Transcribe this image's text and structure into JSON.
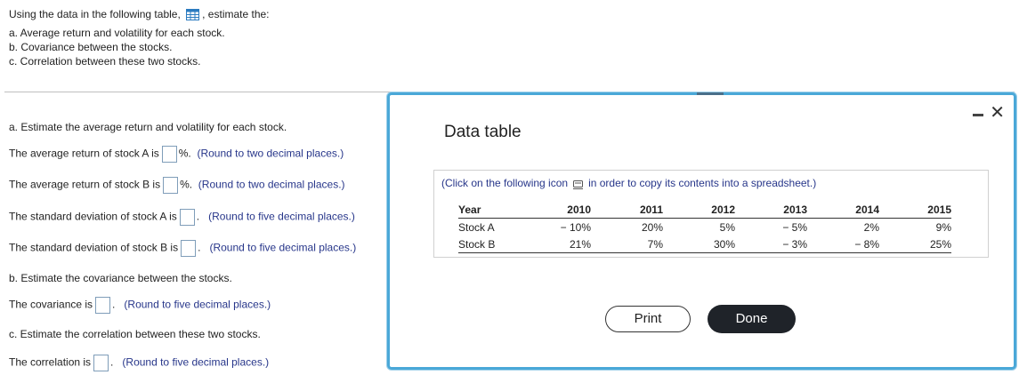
{
  "problem": {
    "intro_before": "Using the data in the following table,",
    "intro_after": ", estimate the:",
    "items": [
      "a. Average return and volatility for each stock.",
      "b. Covariance between the stocks.",
      "c. Correlation between these two stocks."
    ]
  },
  "parts": {
    "a_heading": "a. Estimate the average return and volatility for each stock.",
    "avg_a_label": "The average return of stock A is",
    "avg_a_suffix": "%.",
    "avg_a_hint": "(Round to two decimal places.)",
    "avg_b_label": "The average return of stock B is",
    "avg_b_suffix": "%.",
    "avg_b_hint": "(Round to two decimal places.)",
    "sd_a_label": "The standard deviation of stock A is",
    "sd_a_suffix": ".",
    "sd_a_hint": "(Round to five decimal places.)",
    "sd_b_label": "The standard deviation of stock B is",
    "sd_b_suffix": ".",
    "sd_b_hint": "(Round to five decimal places.)",
    "b_heading": "b. Estimate the covariance between the stocks.",
    "cov_label": "The covariance is",
    "cov_suffix": ".",
    "cov_hint": "(Round to five decimal places.)",
    "c_heading": "c. Estimate the correlation between these two stocks.",
    "corr_label": "The correlation is",
    "corr_suffix": ".",
    "corr_hint": "(Round to five decimal places.)"
  },
  "modal": {
    "title": "Data table",
    "minimize_icon": "minimize-icon",
    "close_icon": "close-icon",
    "caption_before": "(Click on the following icon",
    "caption_after": "in order to copy its contents into a spreadsheet.)",
    "table": {
      "headers": [
        "Year",
        "2010",
        "2011",
        "2012",
        "2013",
        "2014",
        "2015"
      ],
      "rows": [
        [
          "Stock A",
          "− 10%",
          "20%",
          "5%",
          "− 5%",
          "2%",
          "9%"
        ],
        [
          "Stock B",
          "21%",
          "7%",
          "30%",
          "− 3%",
          "− 8%",
          "25%"
        ]
      ]
    },
    "print_label": "Print",
    "done_label": "Done"
  },
  "colors": {
    "hint": "#27368a",
    "modal_border": "#4aa8d8",
    "done_bg": "#1f2329"
  }
}
